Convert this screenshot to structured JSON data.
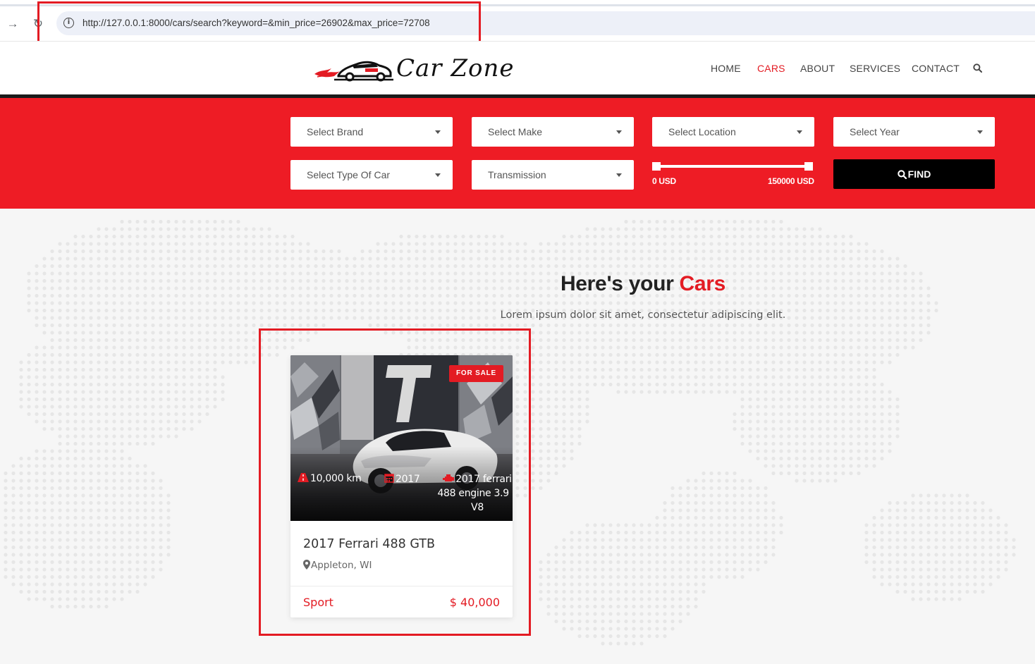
{
  "browser": {
    "url": "http://127.0.0.1:8000/cars/search?keyword=&min_price=26902&max_price=72708"
  },
  "header": {
    "logo_text": "Car Zone",
    "menu": [
      {
        "label": "HOME",
        "active": false
      },
      {
        "label": "CARS",
        "active": true
      },
      {
        "label": "ABOUT",
        "active": false
      },
      {
        "label": "SERVICES",
        "active": false
      },
      {
        "label": "CONTACT",
        "active": false
      }
    ]
  },
  "search": {
    "brand_placeholder": "Select Brand",
    "make_placeholder": "Select Make",
    "location_placeholder": "Select Location",
    "year_placeholder": "Select Year",
    "type_placeholder": "Select Type Of Car",
    "transmission_placeholder": "Transmission",
    "price_min_label": "0 USD",
    "price_max_label": "150000 USD",
    "find_label": "FIND"
  },
  "section": {
    "title_prefix": "Here's your ",
    "title_highlight": "Cars",
    "subtitle": "Lorem ipsum dolor sit amet, consectetur adipiscing elit."
  },
  "cars": [
    {
      "badge": "FOR SALE",
      "mileage": "10,000 km",
      "year": "2017",
      "engine": "2017 ferrari 488 engine 3.9 L V8",
      "title": "2017 Ferrari 488 GTB",
      "location": "Appleton, WI",
      "type": "Sport",
      "price": "$ 40,000"
    }
  ],
  "colors": {
    "accent": "#e31b23",
    "band": "#ee1c25",
    "dark": "#000000"
  },
  "icons": {
    "back": "arrow-right-icon",
    "reload": "reload-icon",
    "info": "info-icon",
    "search": "search-icon",
    "caret": "chevron-down-icon",
    "mileage": "road-icon",
    "year": "calendar-icon",
    "engine": "engine-icon",
    "location": "map-marker-icon"
  }
}
